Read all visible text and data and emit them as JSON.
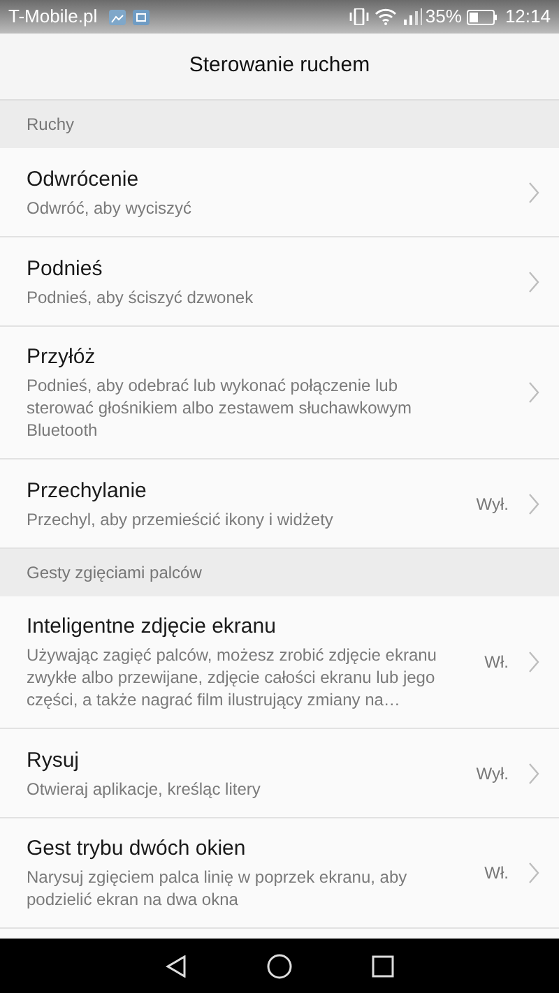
{
  "status_bar": {
    "carrier": "T-Mobile.pl",
    "battery": "35%",
    "time": "12:14"
  },
  "header": {
    "title": "Sterowanie ruchem"
  },
  "sections": [
    {
      "title": "Ruchy",
      "items": [
        {
          "title": "Odwrócenie",
          "description": "Odwróć, aby wyciszyć"
        },
        {
          "title": "Podnieś",
          "description": "Podnieś, aby ściszyć dzwonek"
        },
        {
          "title": "Przyłóż",
          "description": "Podnieś, aby odebrać lub wykonać połączenie lub sterować głośnikiem albo zestawem słuchawkowym Bluetooth"
        },
        {
          "title": "Przechylanie",
          "description": "Przechyl, aby przemieścić ikony i widżety",
          "value": "Wył."
        }
      ]
    },
    {
      "title": "Gesty zgięciami palców",
      "items": [
        {
          "title": "Inteligentne zdjęcie ekranu",
          "description": "Używając zagięć palców, możesz zrobić zdjęcie ekranu zwykłe albo przewijane, zdjęcie całości ekranu lub jego części, a także nagrać film ilustrujący zmiany na…",
          "value": "Wł."
        },
        {
          "title": "Rysuj",
          "description": "Otwieraj aplikacje, kreśląc litery",
          "value": "Wył."
        },
        {
          "title": "Gest trybu dwóch okien",
          "description": "Narysuj zgięciem palca linię w poprzek ekranu, aby podzielić ekran na dwa okna",
          "value": "Wł."
        }
      ]
    }
  ]
}
